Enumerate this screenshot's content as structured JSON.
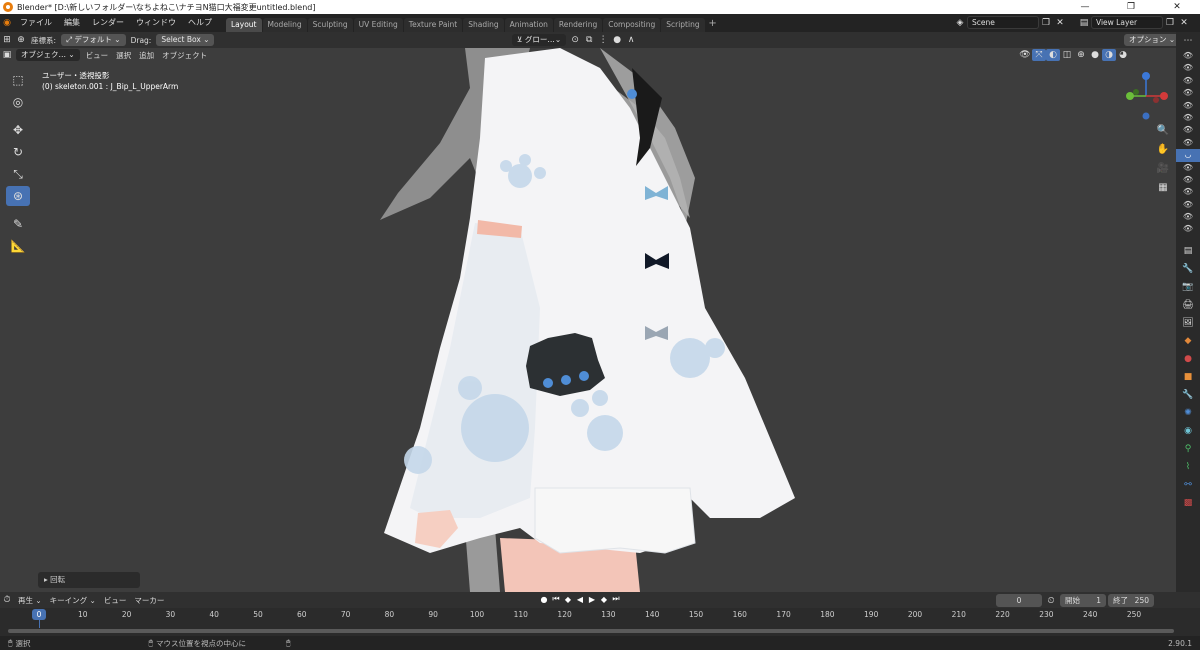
{
  "titlebar": {
    "title": "Blender* [D:\\新しいフォルダー\\なちよねこ\\ナチヨN猫口大福変更untitled.blend]",
    "minimize": "—",
    "maximize": "❐",
    "close": "✕"
  },
  "menu": {
    "file": "ファイル",
    "edit": "編集",
    "render": "レンダー",
    "window": "ウィンドウ",
    "help": "ヘルプ"
  },
  "workspaces": [
    {
      "label": "Layout",
      "active": true
    },
    {
      "label": "Modeling"
    },
    {
      "label": "Sculpting"
    },
    {
      "label": "UV Editing"
    },
    {
      "label": "Texture Paint"
    },
    {
      "label": "Shading"
    },
    {
      "label": "Animation"
    },
    {
      "label": "Rendering"
    },
    {
      "label": "Compositing"
    },
    {
      "label": "Scripting"
    }
  ],
  "scene": {
    "value": "Scene"
  },
  "view_layer": {
    "value": "View Layer"
  },
  "header": {
    "orientation_label": "座標系:",
    "orientation_value": "デフォルト",
    "drag_label": "Drag:",
    "drag_value": "Select Box",
    "transform_value": "グロー…",
    "options": "オプション"
  },
  "viewport_menu": {
    "mode": "オブジェク…",
    "view": "ビュー",
    "select": "選択",
    "add": "追加",
    "object": "オブジェクト"
  },
  "view_info": {
    "projection": "ユーザー・透視投影",
    "object": "(0) skeleton.001 : J_Bip_L_UpperArm"
  },
  "gizmo": {
    "z": "Z",
    "y": "Y",
    "x": "X"
  },
  "operator_panel": {
    "label": "回転"
  },
  "timeline": {
    "playback": "再生",
    "keying": "キーイング",
    "view": "ビュー",
    "marker": "マーカー",
    "current_frame": "0",
    "start_label": "開始",
    "start_value": "1",
    "end_label": "終了",
    "end_value": "250",
    "ticks": [
      "0",
      "10",
      "20",
      "30",
      "40",
      "50",
      "60",
      "70",
      "80",
      "90",
      "100",
      "110",
      "120",
      "130",
      "140",
      "150",
      "160",
      "170",
      "180",
      "190",
      "200",
      "210",
      "220",
      "230",
      "240",
      "250"
    ]
  },
  "statusbar": {
    "select": "選択",
    "center_view": "マウス位置を視点の中心に",
    "version": "2.90.1"
  },
  "colors": {
    "accent": "#4772b3",
    "viewport_bg": "#3d3d3d",
    "panel_bg": "#303030"
  }
}
